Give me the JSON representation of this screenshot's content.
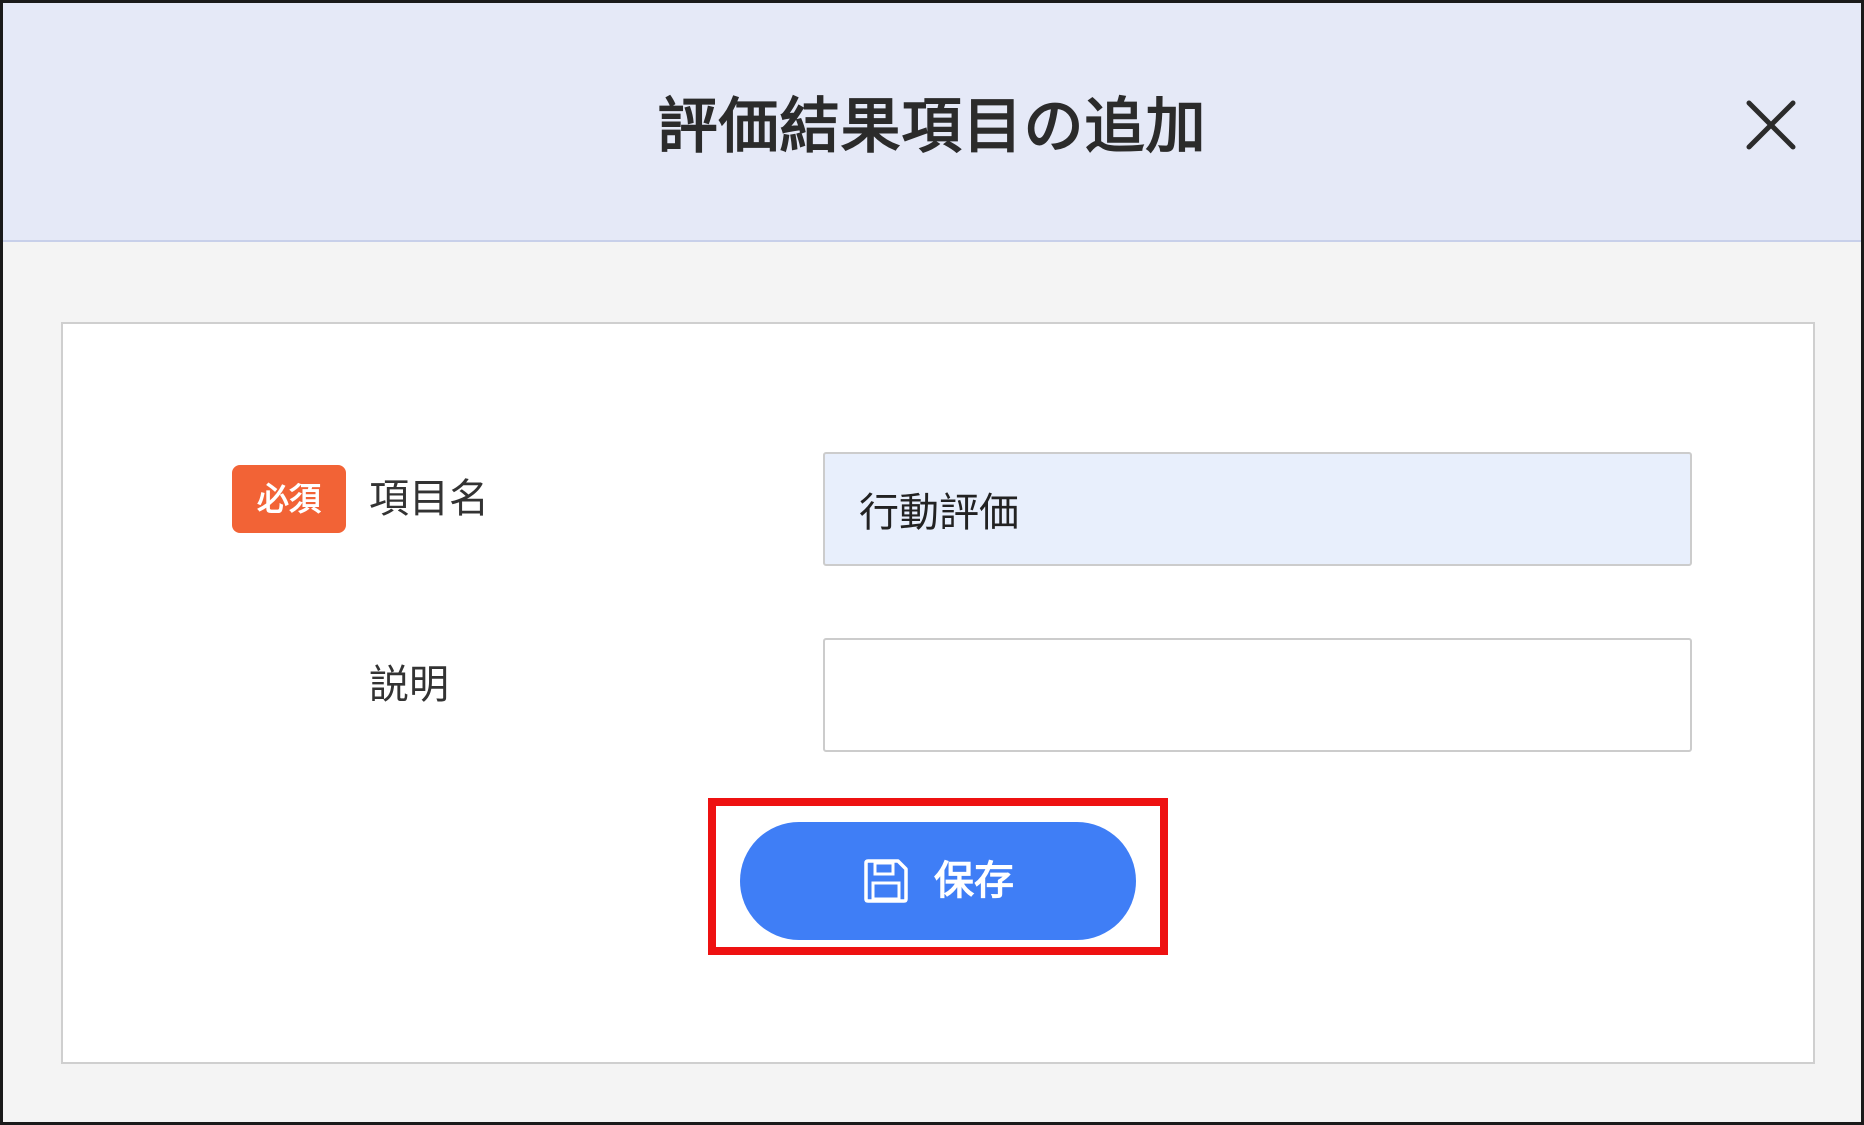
{
  "dialog": {
    "title": "評価結果項目の追加",
    "close_icon": "close-icon"
  },
  "form": {
    "item_name": {
      "required_badge": "必須",
      "label": "項目名",
      "value": "行動評価"
    },
    "description": {
      "label": "説明",
      "value": ""
    },
    "save": {
      "label": "保存",
      "icon": "floppy-disk-icon"
    }
  },
  "colors": {
    "header_bg": "#e5e9f7",
    "required_badge": "#f26336",
    "save_button": "#3f7ef6",
    "highlight": "#ee1111",
    "active_field_bg": "#e8effc"
  }
}
